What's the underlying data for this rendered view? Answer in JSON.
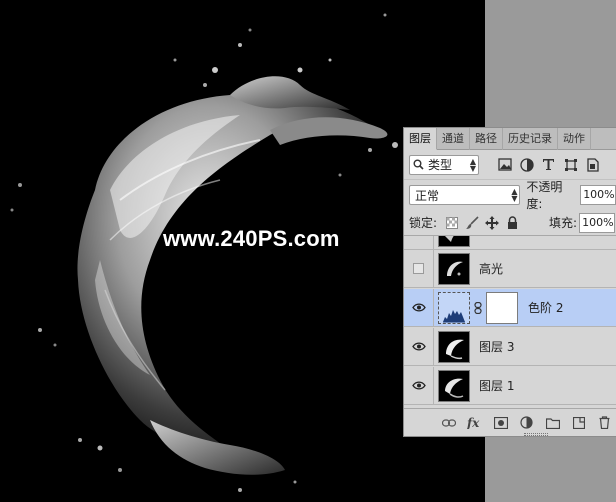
{
  "watermark": "www.240PS.com",
  "panel": {
    "tabs": [
      {
        "label": "图层",
        "active": true
      },
      {
        "label": "通道",
        "active": false
      },
      {
        "label": "路径",
        "active": false
      },
      {
        "label": "历史记录",
        "active": false
      },
      {
        "label": "动作",
        "active": false
      }
    ],
    "filter_kind": "类型",
    "blend_mode": "正常",
    "opacity_label": "不透明度:",
    "opacity_value": "100%",
    "lock_label": "锁定:",
    "fill_label": "填充:",
    "fill_value": "100%",
    "layers": [
      {
        "name": "",
        "visible": true,
        "selected": false,
        "type": "pixel"
      },
      {
        "name": "高光",
        "visible": false,
        "selected": false,
        "type": "pixel"
      },
      {
        "name": "色阶 2",
        "visible": true,
        "selected": true,
        "type": "adjustment"
      },
      {
        "name": "图层 3",
        "visible": true,
        "selected": false,
        "type": "pixel"
      },
      {
        "name": "图层 1",
        "visible": true,
        "selected": false,
        "type": "pixel"
      }
    ]
  },
  "colors": {
    "canvas": "#000000",
    "pasteboard": "#9a9a9a",
    "panel_bg": "#d6d6d6",
    "selection": "#b8cef5"
  }
}
